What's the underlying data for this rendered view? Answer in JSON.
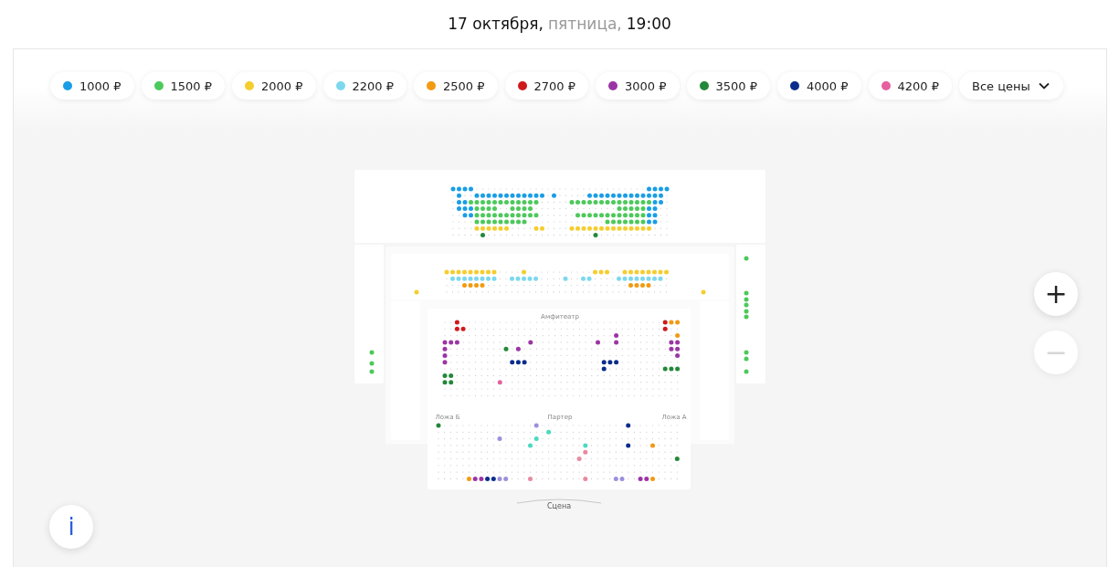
{
  "header": {
    "date": "17 октября,",
    "weekday": "пятница,",
    "time": "19:00"
  },
  "price_filters": [
    {
      "label": "1000 ₽",
      "color": "#1a9ee6"
    },
    {
      "label": "1500 ₽",
      "color": "#4cc95a"
    },
    {
      "label": "2000 ₽",
      "color": "#f5cd2f"
    },
    {
      "label": "2200 ₽",
      "color": "#7dd8ee"
    },
    {
      "label": "2500 ₽",
      "color": "#f29a12"
    },
    {
      "label": "2700 ₽",
      "color": "#d0191b"
    },
    {
      "label": "3000 ₽",
      "color": "#9b35a5"
    },
    {
      "label": "3500 ₽",
      "color": "#23883a"
    },
    {
      "label": "4000 ₽",
      "color": "#0a2c8c"
    },
    {
      "label": "4200 ₽",
      "color": "#e4609f"
    }
  ],
  "all_prices": {
    "label": "Все цены",
    "expanded": false
  },
  "map_labels": [
    {
      "kind": "section",
      "text": "Амфитеатр"
    },
    {
      "kind": "section",
      "text": "Ложа Б"
    },
    {
      "kind": "section",
      "text": "Партер"
    },
    {
      "kind": "section",
      "text": "Ложа А"
    },
    {
      "kind": "stage",
      "text": "Сцена"
    }
  ],
  "zoom": [
    {
      "label": "+",
      "disabled": false
    },
    {
      "label": "−",
      "disabled": true
    }
  ],
  "info_button": {
    "label": "i"
  }
}
